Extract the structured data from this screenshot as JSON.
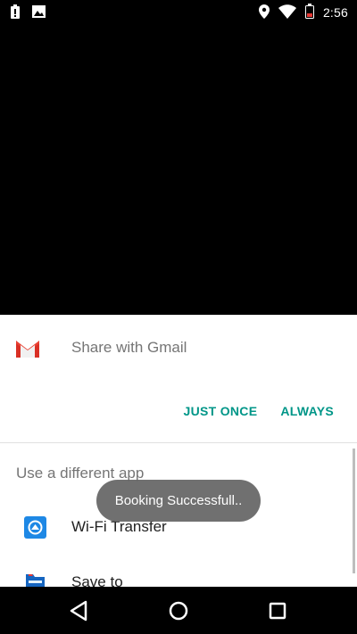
{
  "status_bar": {
    "time": "2:56",
    "icons": [
      "battery-alert-icon",
      "image-icon",
      "location-icon",
      "wifi-icon",
      "battery-icon"
    ]
  },
  "share_sheet": {
    "default_app_label": "Share with Gmail",
    "default_app_icon": "gmail-icon",
    "just_once_label": "JUST ONCE",
    "always_label": "ALWAYS",
    "different_app_label": "Use a different app",
    "apps": [
      {
        "label": "Wi-Fi Transfer",
        "icon": "wifi-transfer-icon"
      },
      {
        "label": "Save to",
        "icon": "save-to-folder-icon"
      }
    ]
  },
  "toast": {
    "message": "Booking Successfull.."
  },
  "nav_bar": {
    "icons": [
      "back-icon",
      "home-icon",
      "recents-icon"
    ]
  },
  "colors": {
    "accent": "#009688",
    "background": "#000000",
    "sheet": "#ffffff",
    "toast": "#646464"
  }
}
